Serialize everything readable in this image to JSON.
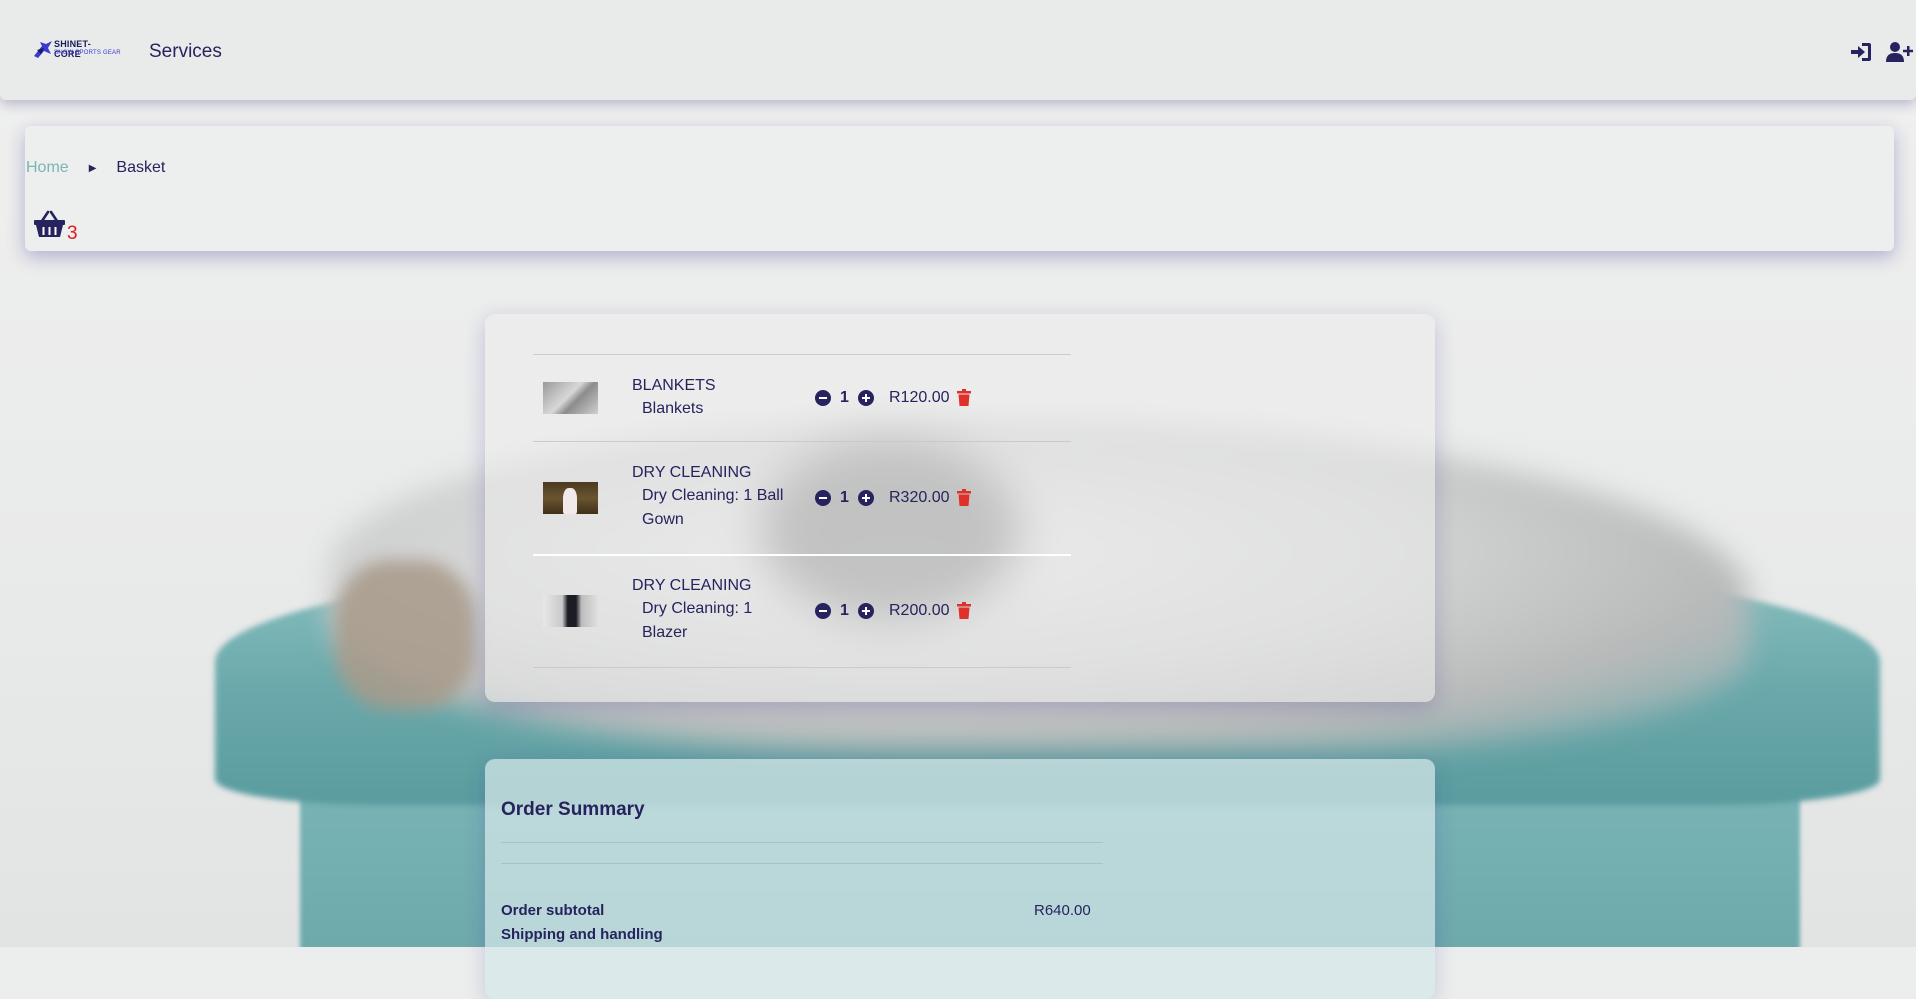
{
  "header": {
    "logo_name": "SHINET-CORE",
    "logo_tagline": "SNOW SPORTS GEAR",
    "nav_services": "Services",
    "icons": [
      "login-icon",
      "register-user-icon"
    ]
  },
  "breadcrumb": {
    "home": "Home",
    "current": "Basket"
  },
  "cart": {
    "count": "3",
    "icon": "basket-icon"
  },
  "items": [
    {
      "category": "BLANKETS",
      "description": "Blankets",
      "quantity": "1",
      "price": "R120.00"
    },
    {
      "category": "DRY CLEANING",
      "description": "Dry Cleaning: 1 Ball Gown",
      "quantity": "1",
      "price": "R320.00"
    },
    {
      "category": "DRY CLEANING",
      "description": "Dry Cleaning: 1 Blazer",
      "quantity": "1",
      "price": "R200.00"
    }
  ],
  "summary": {
    "title": "Order Summary",
    "subtotal_label": "Order subtotal",
    "subtotal_value": "R640.00",
    "shipping_label": "Shipping and handling"
  },
  "colors": {
    "primary": "#26235e",
    "accent_link": "#7cb5b9",
    "cart_count": "#e21b1b",
    "delete": "#e0302a"
  }
}
